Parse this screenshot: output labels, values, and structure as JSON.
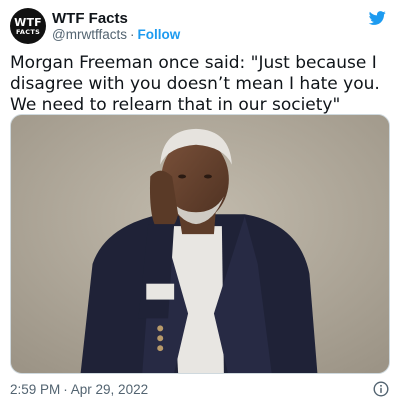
{
  "author": {
    "name": "WTF Facts",
    "handle": "@mrwtffacts",
    "separator": "·",
    "follow_label": "Follow",
    "avatar_text_line1": "WTF",
    "avatar_text_line2": "FACTS"
  },
  "tweet": {
    "text": "Morgan Freeman once said: \"Just because I disagree with you doesn’t mean I hate you. We need to relearn that in our society\""
  },
  "footer": {
    "time": "2:59 PM",
    "separator": "·",
    "date": "Apr 29, 2022"
  },
  "icons": {
    "brand": "twitter-bird-icon",
    "info": "info-icon"
  },
  "colors": {
    "accent": "#1d9bf0",
    "text": "#0f1419",
    "secondary": "#536471"
  }
}
